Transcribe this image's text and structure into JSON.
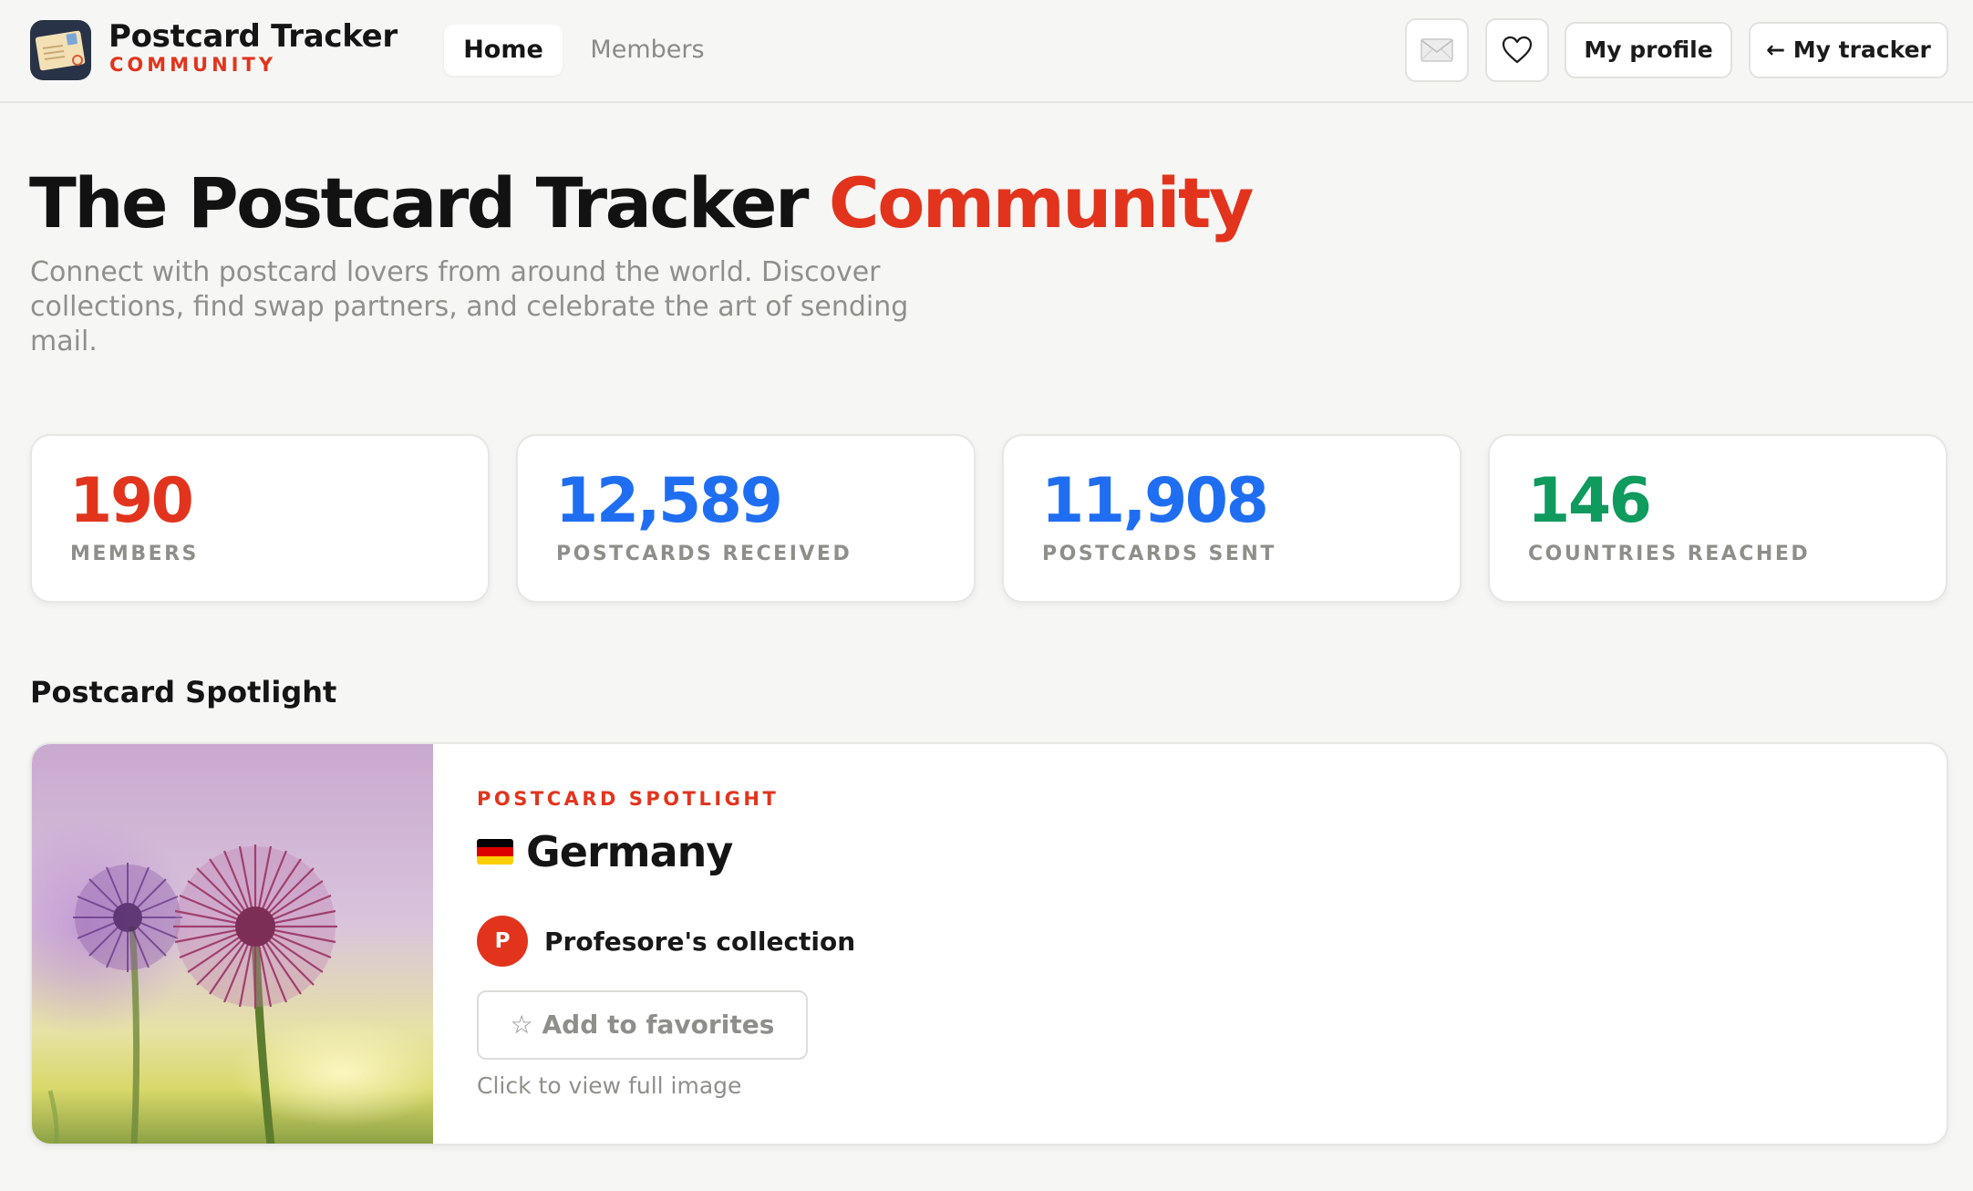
{
  "header": {
    "brand_title": "Postcard Tracker",
    "brand_subtitle": "COMMUNITY",
    "brand_icon": "postcard-icon",
    "nav": [
      {
        "label": "Home",
        "active": true
      },
      {
        "label": "Members",
        "active": false
      }
    ],
    "icons": {
      "mail": "envelope-icon",
      "favorites": "heart-icon"
    },
    "my_profile_label": "My profile",
    "my_tracker_label": "← My tracker"
  },
  "hero": {
    "title_main": "The Postcard Tracker",
    "title_accent": "Community",
    "description": "Connect with postcard lovers from around the world. Discover collections, find swap partners, and celebrate the art of sending mail."
  },
  "stats": [
    {
      "value": "190",
      "label": "MEMBERS",
      "color": "#e2341d"
    },
    {
      "value": "12,589",
      "label": "POSTCARDS RECEIVED",
      "color": "#1f6ef2"
    },
    {
      "value": "11,908",
      "label": "POSTCARDS SENT",
      "color": "#1f6ef2"
    },
    {
      "value": "146",
      "label": "COUNTRIES REACHED",
      "color": "#0f9a5e"
    }
  ],
  "spotlight": {
    "section_title": "Postcard Spotlight",
    "kicker": "POSTCARD SPOTLIGHT",
    "country": "Germany",
    "flag_colors": [
      "#000000",
      "#dd0000",
      "#ffce00"
    ],
    "owner_initial": "P",
    "owner_name": "Profesore's collection",
    "favorite_label": "☆ Add to favorites",
    "view_hint": "Click to view full image"
  },
  "colors": {
    "accent": "#e2341d",
    "blue": "#1f6ef2",
    "green": "#0f9a5e"
  }
}
